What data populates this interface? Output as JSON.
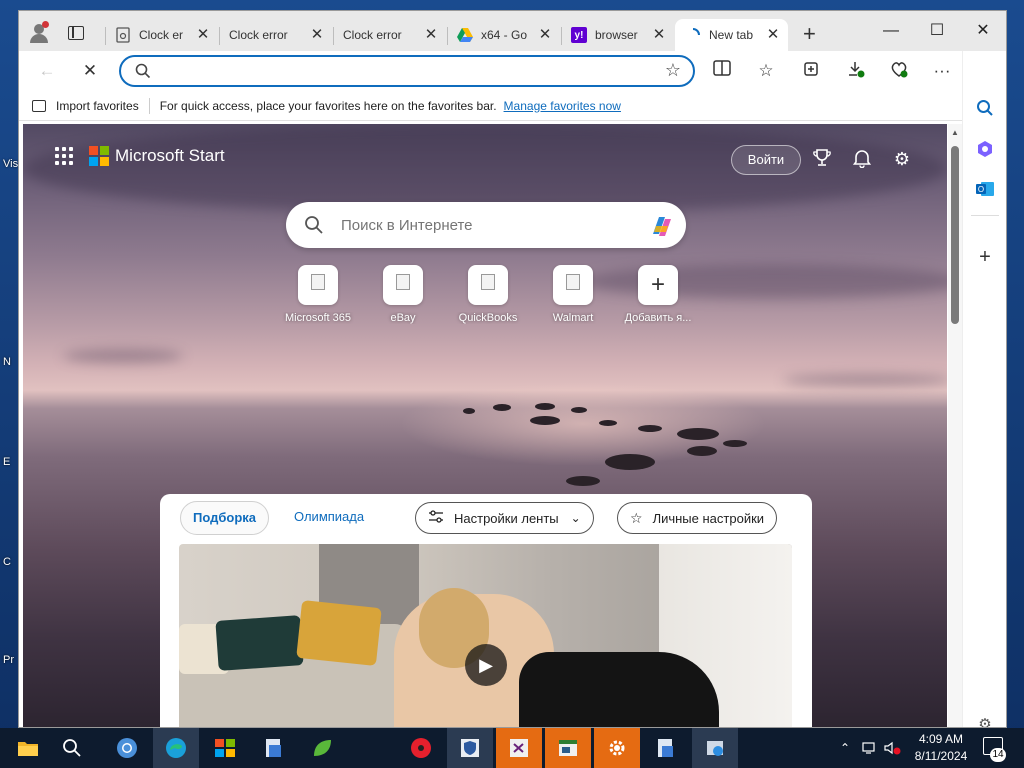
{
  "desktop": {
    "icon_labels": [
      "Vis",
      "N",
      "E",
      "C",
      "Pr"
    ]
  },
  "browser": {
    "tabs": [
      {
        "title": "Clock er",
        "favicon": "page-lock-icon",
        "active": false
      },
      {
        "title": "Clock error",
        "favicon": "none",
        "active": false
      },
      {
        "title": "Clock error",
        "favicon": "none",
        "active": false
      },
      {
        "title": "x64 - Go",
        "favicon": "google-drive-icon",
        "active": false
      },
      {
        "title": "browser",
        "favicon": "yahoo-icon",
        "active": false
      },
      {
        "title": "New tab",
        "favicon": "loading-spinner-icon",
        "active": true
      }
    ],
    "window_controls": {
      "minimize": "—",
      "maximize": "☐",
      "close": "✕"
    },
    "address_bar": {
      "value": "",
      "placeholder": ""
    },
    "favorites_bar": {
      "import_label": "Import favorites",
      "hint": "For quick access, place your favorites here on the favorites bar.",
      "manage_link": "Manage favorites now"
    }
  },
  "start_page": {
    "brand": "Microsoft Start",
    "login_button": "Войти",
    "search_placeholder": "Поиск в Интернете",
    "quick_links": [
      {
        "label": "Microsoft 365"
      },
      {
        "label": "eBay"
      },
      {
        "label": "QuickBooks"
      },
      {
        "label": "Walmart"
      },
      {
        "label": "Добавить я..."
      }
    ],
    "feed": {
      "tabs": [
        {
          "label": "Подборка",
          "active": true
        },
        {
          "label": "Олимпиада",
          "active": false
        }
      ],
      "feed_settings": "Настройки ленты",
      "personal_settings": "Личные настройки"
    }
  },
  "taskbar": {
    "clock_time": "4:09 AM",
    "clock_date": "8/11/2024",
    "notification_count": "14"
  },
  "colors": {
    "accent": "#0f6cbd",
    "taskbar": "#0d1b2e",
    "active_orange": "#e56b12"
  }
}
